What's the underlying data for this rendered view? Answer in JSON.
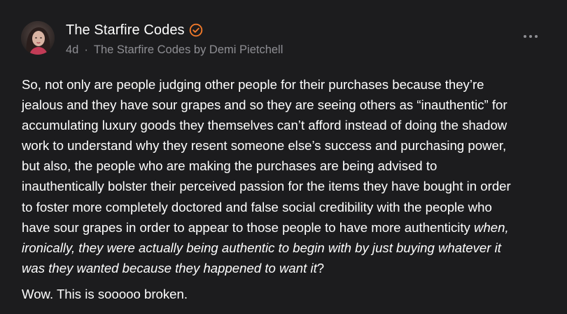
{
  "post": {
    "author": {
      "name": "The Starfire Codes",
      "verified_icon": "verified-check-icon",
      "accent_color": "#f0792a"
    },
    "meta": {
      "time": "4d",
      "separator": "·",
      "publication": "The Starfire Codes by Demi Pietchell"
    },
    "more_icon": "more-horizontal-icon",
    "body": {
      "lines": [
        "So, not only are people judging other people for their purchases because they’re",
        "jealous and they have sour grapes and so they are seeing others as “inauthentic” for",
        "accumulating luxury goods they themselves can’t afford instead of doing the shadow",
        "work to understand why they resent someone else’s success and purchasing power,",
        "but also, the people who are making the purchases are being advised to",
        "inauthentically bolster their perceived passion for the items they have bought in order",
        "to foster more completely doctored and false social credibility with the people who"
      ],
      "line8_plain": "have sour grapes in order to appear to those people to have more authenticity ",
      "line8_italic": "when,",
      "line9_italic": "ironically, they were actually being authentic to begin with by just buying whatever it",
      "line10_italic": "was they wanted because they happened to want it",
      "line10_plain": "?",
      "closing": "Wow. This is sooooo broken."
    }
  }
}
